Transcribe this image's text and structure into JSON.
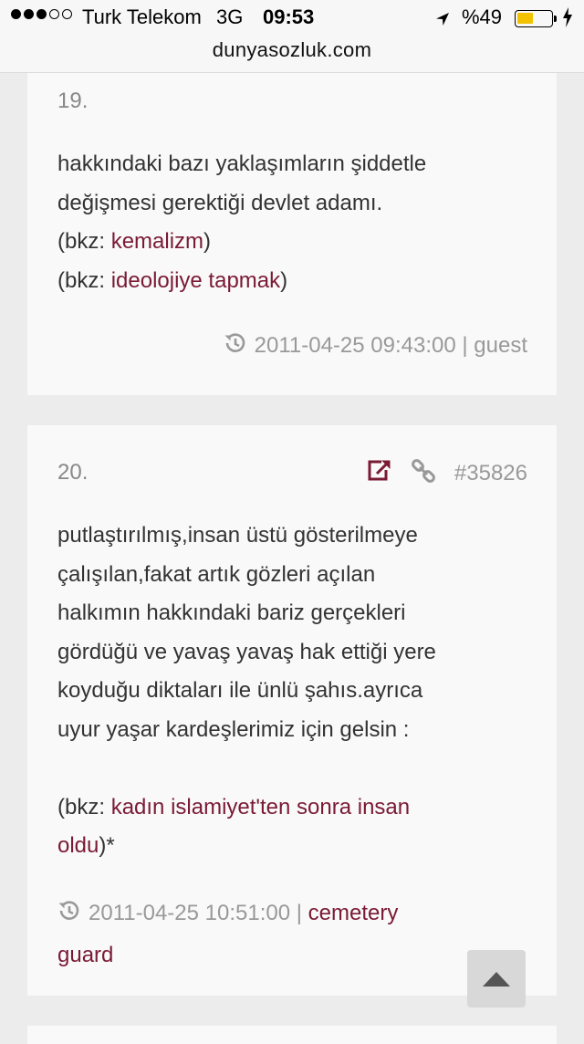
{
  "status_bar": {
    "carrier": "Turk Telekom",
    "network": "3G",
    "time": "09:53",
    "battery": "%49",
    "battery_level": 0.49,
    "signal_bars_filled": 3,
    "signal_bars_total": 5
  },
  "browser": {
    "url": "dunyasozluk.com"
  },
  "entries": [
    {
      "number": "19.",
      "text_lines": [
        "hakkındaki bazı yaklaşımların şiddetle",
        "değişmesi gerektiği devlet adamı."
      ],
      "refs": [
        {
          "prefix": "(bkz: ",
          "link": "kemalizm",
          "suffix": ")"
        },
        {
          "prefix": "(bkz: ",
          "link": "ideolojiye tapmak",
          "suffix": ")"
        }
      ],
      "timestamp": "2011-04-25 09:43:00",
      "separator": "|",
      "author": "guest"
    },
    {
      "number": "20.",
      "entry_id": "#35826",
      "text_lines": [
        "putlaştırılmış,insan üstü gösterilmeye",
        "çalışılan,fakat artık gözleri açılan",
        "halkımın hakkındaki bariz gerçekleri",
        "gördüğü ve yavaş yavaş hak ettiği yere",
        "koyduğu diktaları ile ünlü şahıs.ayrıca",
        "uyur yaşar kardeşlerimiz için gelsin :"
      ],
      "ref_prefix": "(bkz: ",
      "ref_link_line1": "kadın islamiyet'ten sonra insan",
      "ref_link_line2": "oldu",
      "ref_suffix": ")*",
      "timestamp": "2011-04-25 10:51:00",
      "separator": "|",
      "author_line1": "cemetery",
      "author_line2": "guard"
    }
  ],
  "icons": {
    "history": "history-icon",
    "share": "external-link-icon",
    "permalink": "chain-link-icon",
    "scroll_top": "caret-up-icon"
  },
  "colors": {
    "link": "#7a1a35",
    "meta": "#999999",
    "card": "#f9f9f9",
    "background": "#ececec"
  }
}
